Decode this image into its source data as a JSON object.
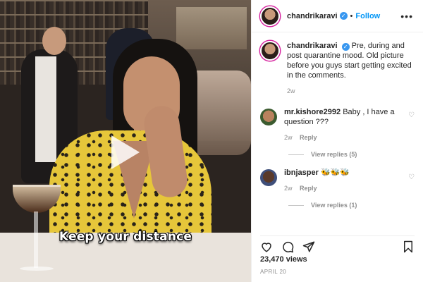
{
  "post": {
    "author": "chandrikaravi",
    "follow_label": "Follow",
    "media_caption": "Keep your distance",
    "views": "23,470 views",
    "date": "APRIL 20"
  },
  "caption_comment": {
    "username": "chandrikaravi",
    "text": "Pre, during and post quarantine mood. Old picture before you guys start getting excited in the comments.",
    "time": "2w"
  },
  "comments": [
    {
      "username": "mr.kishore2992",
      "text": "Baby , I have a question ???",
      "time": "2w",
      "reply_label": "Reply",
      "view_replies": "View replies (5)"
    },
    {
      "username": "ibnjasper",
      "text": "🐝🐝🐝",
      "time": "2w",
      "reply_label": "Reply",
      "view_replies": "View replies (1)"
    }
  ],
  "icons": [
    "heart-icon",
    "comment-icon",
    "share-icon",
    "bookmark-icon",
    "play-icon",
    "more-icon",
    "verified-icon"
  ]
}
